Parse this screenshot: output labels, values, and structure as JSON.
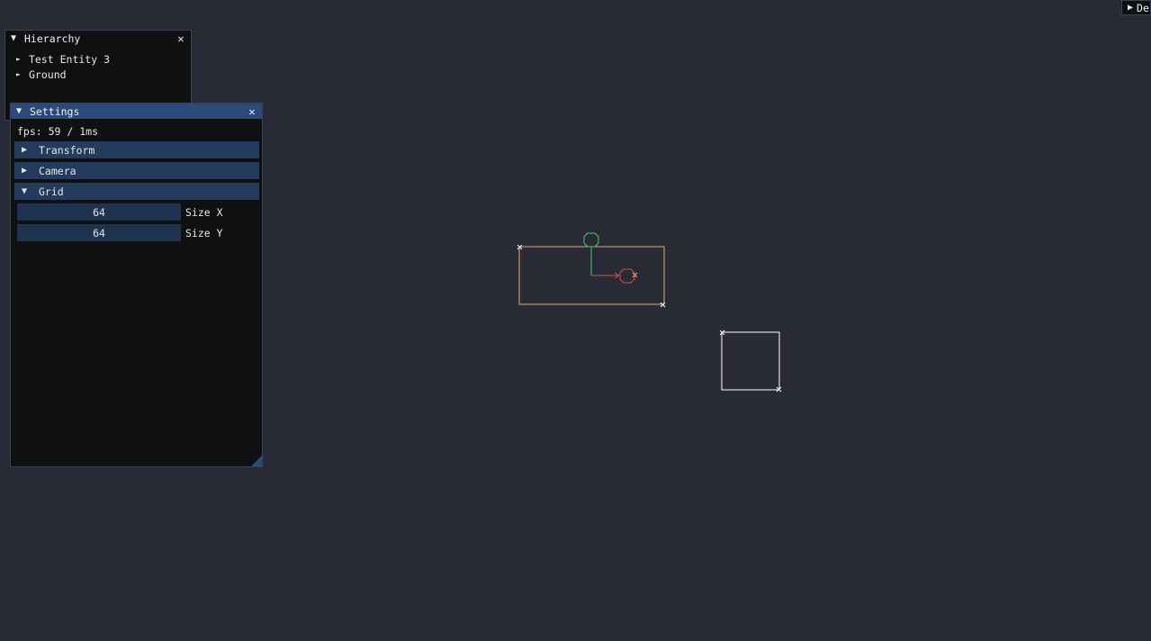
{
  "hierarchy": {
    "title": "Hierarchy",
    "items": [
      {
        "label": "Test Entity 3"
      },
      {
        "label": "Ground"
      }
    ]
  },
  "settings": {
    "title": "Settings",
    "fps": "fps: 59 / 1ms",
    "sections": {
      "transform": "Transform",
      "camera": "Camera",
      "grid": "Grid"
    },
    "grid": {
      "size_x_value": "64",
      "size_x_label": "Size X",
      "size_y_value": "64",
      "size_y_label": "Size Y"
    }
  },
  "corner_button": {
    "label": "De"
  },
  "icons": {
    "collapse": "▼",
    "expand": "▶",
    "tree_expand": "►",
    "close": "✕"
  },
  "colors": {
    "background": "#282a36",
    "window_bg": "#0f1011",
    "title_active": "#2a4a7a",
    "header_bg": "#233b5c",
    "selection_outline": "#e8a86a",
    "gizmo_y": "#3ecf6a",
    "gizmo_x": "#e04a4a",
    "entity_outline": "#ffffff"
  }
}
